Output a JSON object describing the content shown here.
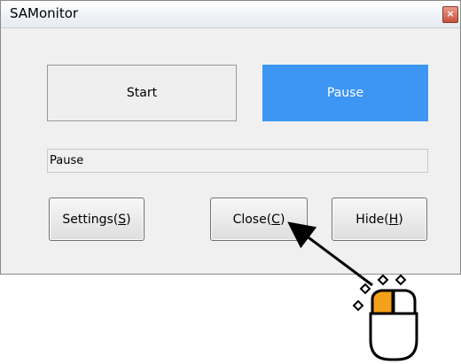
{
  "window": {
    "title": "SAMonitor",
    "close_glyph": "×"
  },
  "buttons": {
    "start": "Start",
    "pause": "Pause",
    "settings": {
      "text": "Settings(",
      "key": "S",
      "end": ")"
    },
    "close": {
      "text": "Close(",
      "key": "C",
      "end": ")"
    },
    "hide": {
      "text": "Hide(",
      "key": "H",
      "end": ")"
    }
  },
  "status": {
    "value": "Pause"
  },
  "annotation": {
    "icon": "mouse-left-click-icon",
    "colors": {
      "button_highlight": "#f5a01a",
      "pause_accent": "#3d95f4"
    }
  }
}
